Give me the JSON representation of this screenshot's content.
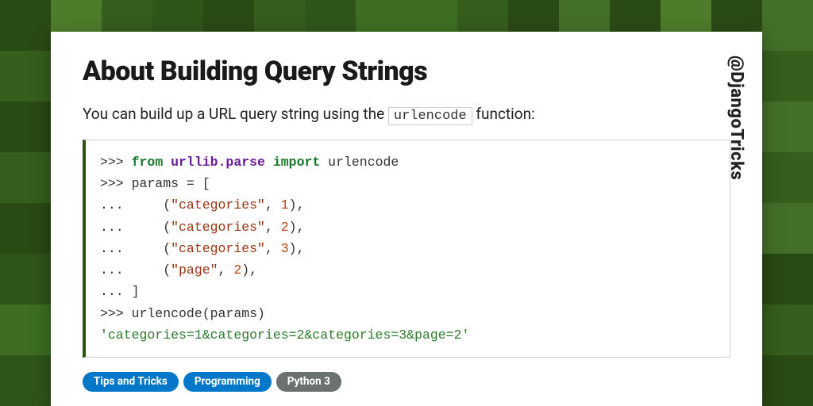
{
  "handle": "@DjangoTricks",
  "title": "About Building Query Strings",
  "intro_before": "You can build up a URL query string using the ",
  "intro_code": "urlencode",
  "intro_after": " function:",
  "code": {
    "l1_prompt": ">>> ",
    "l1_kw1": "from",
    "l1_mod": "urllib.parse",
    "l1_kw2": "import",
    "l1_rest": " urlencode",
    "l2": ">>> params = [",
    "l3_pre": "...     (",
    "l3_str": "\"categories\"",
    "l3_mid": ", ",
    "l3_num": "1",
    "l3_end": "),",
    "l4_pre": "...     (",
    "l4_str": "\"categories\"",
    "l4_mid": ", ",
    "l4_num": "2",
    "l4_end": "),",
    "l5_pre": "...     (",
    "l5_str": "\"categories\"",
    "l5_mid": ", ",
    "l5_num": "3",
    "l5_end": "),",
    "l6_pre": "...     (",
    "l6_str": "\"page\"",
    "l6_mid": ", ",
    "l6_num": "2",
    "l6_end": "),",
    "l7": "... ]",
    "l8": ">>> urlencode(params)",
    "l9": "'categories=1&categories=2&categories=3&page=2'"
  },
  "tags": [
    {
      "label": "Tips and Tricks",
      "cls": "tag-blue"
    },
    {
      "label": "Programming",
      "cls": "tag-blue"
    },
    {
      "label": "Python 3",
      "cls": "tag-gray"
    }
  ],
  "bg_shades": [
    "#2a4a14",
    "#3d6e21",
    "#446f28",
    "#2f5518",
    "#4d7c2a",
    "#365e1d",
    "#2a4a14",
    "#3d6e21",
    "#365e1d",
    "#2a4a14",
    "#4d7c2a",
    "#3d6e21",
    "#2f5518",
    "#446f28",
    "#2a4a14",
    "#365e1d"
  ]
}
